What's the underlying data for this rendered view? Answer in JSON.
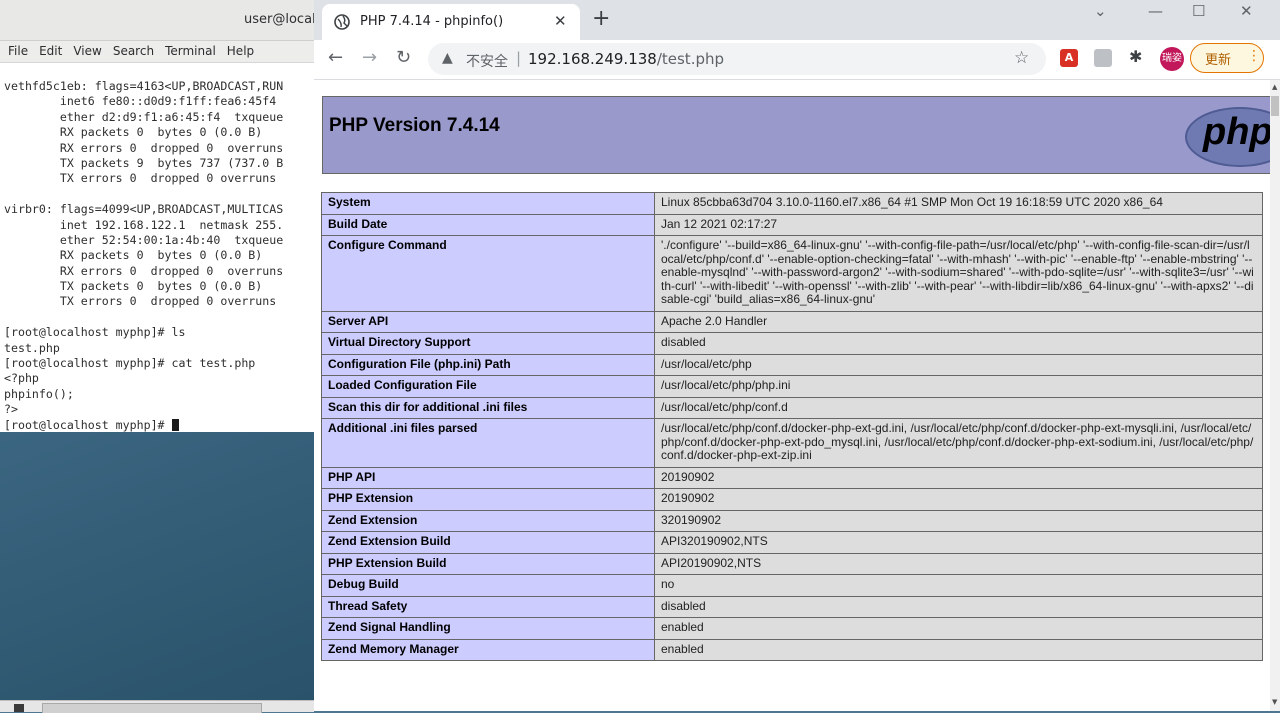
{
  "terminal": {
    "title": "user@localh",
    "menu": [
      "File",
      "Edit",
      "View",
      "Search",
      "Terminal",
      "Help"
    ],
    "lines": [
      "vethfd5c1eb: flags=4163<UP,BROADCAST,RUN",
      "        inet6 fe80::d0d9:f1ff:fea6:45f4",
      "        ether d2:d9:f1:a6:45:f4  txqueue",
      "        RX packets 0  bytes 0 (0.0 B)",
      "        RX errors 0  dropped 0  overruns",
      "        TX packets 9  bytes 737 (737.0 B",
      "        TX errors 0  dropped 0 overruns",
      "",
      "virbr0: flags=4099<UP,BROADCAST,MULTICAS",
      "        inet 192.168.122.1  netmask 255.",
      "        ether 52:54:00:1a:4b:40  txqueue",
      "        RX packets 0  bytes 0 (0.0 B)",
      "        RX errors 0  dropped 0  overruns",
      "        TX packets 0  bytes 0 (0.0 B)",
      "        TX errors 0  dropped 0 overruns",
      "",
      "[root@localhost myphp]# ls",
      "test.php",
      "[root@localhost myphp]# cat test.php",
      "<?php",
      "phpinfo();",
      "?>"
    ],
    "prompt": "[root@localhost myphp]# "
  },
  "browser": {
    "tab_title": "PHP 7.4.14 - phpinfo()",
    "tab_close": "✕",
    "new_tab": "+",
    "not_secure": "不安全",
    "url_host": "192.168.249.138",
    "url_path": "/test.php",
    "avatar": "瑞姿",
    "update_label": "更新",
    "pdf_ext": "A",
    "window_controls": {
      "collapse": "⌄",
      "minimize": "—",
      "maximize": "☐",
      "close": "✕"
    }
  },
  "php": {
    "version_title": "PHP Version 7.4.14",
    "logo_text": "php",
    "rows": [
      {
        "key": "System",
        "value": "Linux 85cbba63d704 3.10.0-1160.el7.x86_64 #1 SMP Mon Oct 19 16:18:59 UTC 2020 x86_64"
      },
      {
        "key": "Build Date",
        "value": "Jan 12 2021 02:17:27"
      },
      {
        "key": "Configure Command",
        "value": "'./configure' '--build=x86_64-linux-gnu' '--with-config-file-path=/usr/local/etc/php' '--with-config-file-scan-dir=/usr/local/etc/php/conf.d' '--enable-option-checking=fatal' '--with-mhash' '--with-pic' '--enable-ftp' '--enable-mbstring' '--enable-mysqlnd' '--with-password-argon2' '--with-sodium=shared' '--with-pdo-sqlite=/usr' '--with-sqlite3=/usr' '--with-curl' '--with-libedit' '--with-openssl' '--with-zlib' '--with-pear' '--with-libdir=lib/x86_64-linux-gnu' '--with-apxs2' '--disable-cgi' 'build_alias=x86_64-linux-gnu'"
      },
      {
        "key": "Server API",
        "value": "Apache 2.0 Handler"
      },
      {
        "key": "Virtual Directory Support",
        "value": "disabled"
      },
      {
        "key": "Configuration File (php.ini) Path",
        "value": "/usr/local/etc/php"
      },
      {
        "key": "Loaded Configuration File",
        "value": "/usr/local/etc/php/php.ini"
      },
      {
        "key": "Scan this dir for additional .ini files",
        "value": "/usr/local/etc/php/conf.d"
      },
      {
        "key": "Additional .ini files parsed",
        "value": "/usr/local/etc/php/conf.d/docker-php-ext-gd.ini, /usr/local/etc/php/conf.d/docker-php-ext-mysqli.ini, /usr/local/etc/php/conf.d/docker-php-ext-pdo_mysql.ini, /usr/local/etc/php/conf.d/docker-php-ext-sodium.ini, /usr/local/etc/php/conf.d/docker-php-ext-zip.ini"
      },
      {
        "key": "PHP API",
        "value": "20190902"
      },
      {
        "key": "PHP Extension",
        "value": "20190902"
      },
      {
        "key": "Zend Extension",
        "value": "320190902"
      },
      {
        "key": "Zend Extension Build",
        "value": "API320190902,NTS"
      },
      {
        "key": "PHP Extension Build",
        "value": "API20190902,NTS"
      },
      {
        "key": "Debug Build",
        "value": "no"
      },
      {
        "key": "Thread Safety",
        "value": "disabled"
      },
      {
        "key": "Zend Signal Handling",
        "value": "enabled"
      },
      {
        "key": "Zend Memory Manager",
        "value": "enabled"
      }
    ]
  }
}
